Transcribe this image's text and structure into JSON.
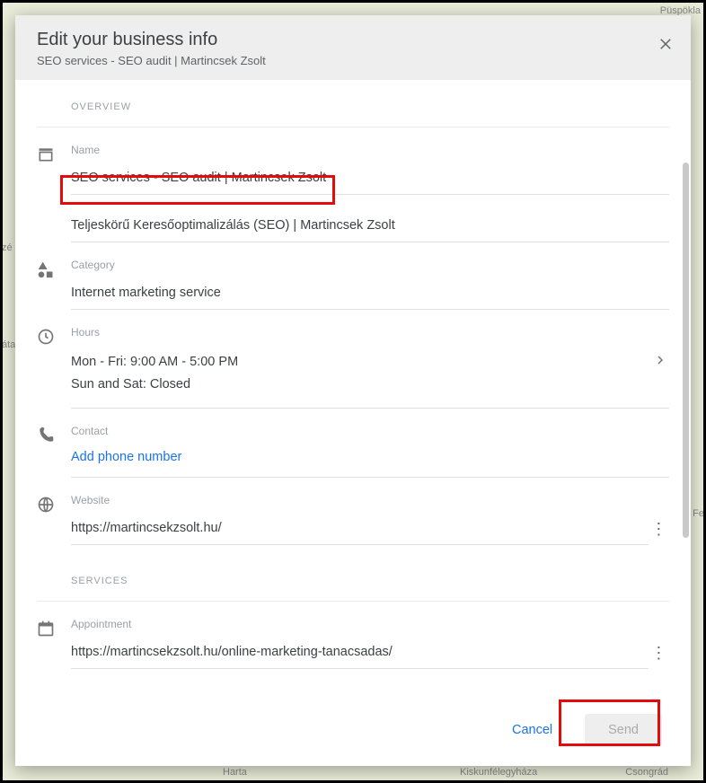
{
  "header": {
    "title": "Edit your business info",
    "subtitle": "SEO services - SEO audit | Martincsek Zsolt"
  },
  "sections": {
    "overview": "OVERVIEW",
    "services": "SERVICES"
  },
  "name": {
    "label": "Name",
    "value1": "SEO services - SEO audit | Martincsek Zsolt",
    "value2": "Teljeskörű Keresőoptimalizálás (SEO) | Martincsek Zsolt"
  },
  "category": {
    "label": "Category",
    "value": "Internet marketing service"
  },
  "hours": {
    "label": "Hours",
    "line1": "Mon - Fri: 9:00 AM - 5:00 PM",
    "line2": "Sun and Sat: Closed"
  },
  "contact": {
    "label": "Contact",
    "add_link": "Add phone number"
  },
  "website": {
    "label": "Website",
    "value": "https://martincsekzsolt.hu/"
  },
  "appointment": {
    "label": "Appointment",
    "value": "https://martincsekzsolt.hu/online-marketing-tanacsadas/"
  },
  "footer": {
    "cancel": "Cancel",
    "send": "Send"
  },
  "map_labels": {
    "a": "Püspökla",
    "b": "Harta",
    "c": "Kiskunfélegyháza",
    "d": "Csongrád",
    "e": "zé",
    "f": "áta",
    "g": "Fe"
  }
}
